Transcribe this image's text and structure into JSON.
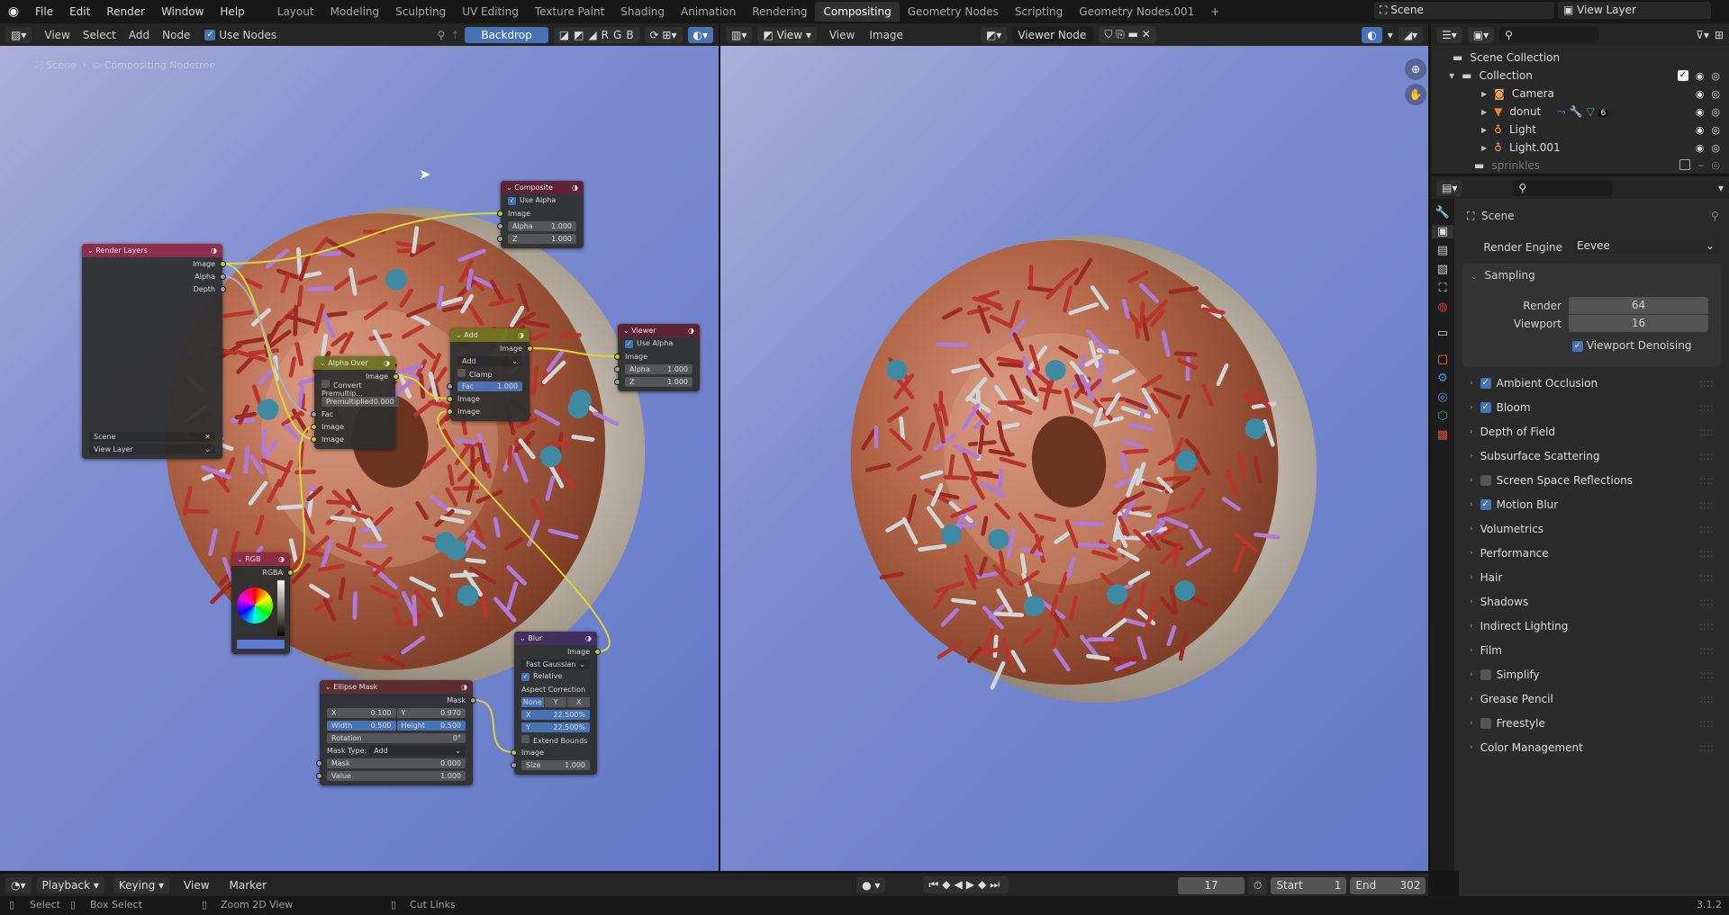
{
  "topbar": {
    "menus": [
      "File",
      "Edit",
      "Render",
      "Window",
      "Help"
    ],
    "workspaces": [
      "Layout",
      "Modeling",
      "Sculpting",
      "UV Editing",
      "Texture Paint",
      "Shading",
      "Animation",
      "Rendering",
      "Compositing",
      "Geometry Nodes",
      "Scripting",
      "Geometry Nodes.001"
    ],
    "active_workspace": "Compositing",
    "add_tab": "+",
    "scene": "Scene",
    "view_layer": "View Layer"
  },
  "node_editor": {
    "menus": [
      "View",
      "Select",
      "Add",
      "Node"
    ],
    "use_nodes_label": "Use Nodes",
    "use_nodes": true,
    "backdrop_label": "Backdrop",
    "channels": [
      "R",
      "G",
      "B"
    ],
    "breadcrumb": [
      "Scene",
      "Compositing Nodetree"
    ]
  },
  "nodes": [
    {
      "id": "render_layers",
      "title": "Render Layers",
      "color": "#8c2a45",
      "rows": [
        {
          "t": "out",
          "label": "Image",
          "s": "color"
        },
        {
          "t": "out",
          "label": "Alpha",
          "s": "value"
        },
        {
          "t": "out",
          "label": "Depth",
          "s": "value"
        },
        {
          "t": "spacer"
        },
        {
          "t": "scene",
          "label": "Scene"
        },
        {
          "t": "drop",
          "label": "View Layer"
        }
      ]
    },
    {
      "id": "composite",
      "title": "Composite",
      "color": "#5c1f2f",
      "rows": [
        {
          "t": "check",
          "label": "Use Alpha",
          "checked": true
        },
        {
          "t": "in",
          "label": "Image",
          "s": "color"
        },
        {
          "t": "field",
          "label": "Alpha",
          "value": "1.000",
          "s": "value"
        },
        {
          "t": "field",
          "label": "Z",
          "value": "1.000",
          "s": "value"
        }
      ]
    },
    {
      "id": "alpha_over",
      "title": "Alpha Over",
      "color": "#6e7320",
      "rows": [
        {
          "t": "out",
          "label": "Image",
          "s": "color"
        },
        {
          "t": "check",
          "label": "Convert Premultip...",
          "checked": false
        },
        {
          "t": "field",
          "label": "Premultiplied",
          "value": "0.000"
        },
        {
          "t": "in",
          "label": "Fac",
          "s": "value"
        },
        {
          "t": "in",
          "label": "Image",
          "s": "color"
        },
        {
          "t": "in",
          "label": "Image",
          "s": "color"
        }
      ]
    },
    {
      "id": "add",
      "title": "Add",
      "color": "#6e7320",
      "rows": [
        {
          "t": "out",
          "label": "Image",
          "s": "color"
        },
        {
          "t": "drop",
          "label": "Add"
        },
        {
          "t": "check",
          "label": "Clamp",
          "checked": false
        },
        {
          "t": "field",
          "label": "Fac",
          "value": "1.000",
          "s": "value",
          "acc": true
        },
        {
          "t": "in",
          "label": "Image",
          "s": "color"
        },
        {
          "t": "in",
          "label": "Image",
          "s": "color"
        }
      ]
    },
    {
      "id": "viewer",
      "title": "Viewer",
      "color": "#5c1f2f",
      "rows": [
        {
          "t": "check",
          "label": "Use Alpha",
          "checked": true
        },
        {
          "t": "in",
          "label": "Image",
          "s": "color"
        },
        {
          "t": "field",
          "label": "Alpha",
          "value": "1.000",
          "s": "value"
        },
        {
          "t": "field",
          "label": "Z",
          "value": "1.000",
          "s": "value"
        }
      ]
    },
    {
      "id": "rgb",
      "title": "RGB",
      "color": "#8c2a45",
      "rows": [
        {
          "t": "out",
          "label": "RGBA",
          "s": "color"
        },
        {
          "t": "color",
          "swatch": "#5a78d4"
        }
      ]
    },
    {
      "id": "ellipse_mask",
      "title": "Ellipse Mask",
      "color": "#5a2a2a",
      "rows": [
        {
          "t": "out",
          "label": "Mask",
          "s": "value"
        },
        {
          "t": "pair",
          "a": {
            "label": "X",
            "value": "0.100"
          },
          "b": {
            "label": "Y",
            "value": "0.970"
          }
        },
        {
          "t": "pair",
          "a": {
            "label": "Width",
            "value": "0.500",
            "acc": true
          },
          "b": {
            "label": "Height",
            "value": "0.500",
            "acc": true
          }
        },
        {
          "t": "field",
          "label": "Rotation",
          "value": "0°"
        },
        {
          "t": "drop",
          "label": "Add",
          "prefix": "Mask Type:"
        },
        {
          "t": "field",
          "label": "Mask",
          "value": "0.000",
          "s": "value"
        },
        {
          "t": "field",
          "label": "Value",
          "value": "1.000",
          "s": "value"
        }
      ]
    },
    {
      "id": "blur",
      "title": "Blur",
      "color": "#3f2a5c",
      "rows": [
        {
          "t": "out",
          "label": "Image",
          "s": "color"
        },
        {
          "t": "drop",
          "label": "Fast Gaussian"
        },
        {
          "t": "check",
          "label": "Relative",
          "checked": true
        },
        {
          "t": "text",
          "label": "Aspect Correction"
        },
        {
          "t": "seg",
          "options": [
            "None",
            "Y",
            "X"
          ],
          "active": "None"
        },
        {
          "t": "field",
          "label": "X",
          "value": "22.500%",
          "acc": true
        },
        {
          "t": "field",
          "label": "Y",
          "value": "22.500%",
          "acc": true
        },
        {
          "t": "check",
          "label": "Extend Bounds",
          "checked": false
        },
        {
          "t": "in",
          "label": "Image",
          "s": "color"
        },
        {
          "t": "field",
          "label": "Size",
          "value": "1.000",
          "s": "value"
        }
      ]
    }
  ],
  "links": [
    [
      "render_layers",
      0,
      "composite",
      1
    ],
    [
      "render_layers",
      0,
      "alpha_over",
      5
    ],
    [
      "render_layers",
      1,
      "alpha_over",
      3
    ],
    [
      "rgb",
      0,
      "alpha_over",
      4
    ],
    [
      "alpha_over",
      0,
      "add",
      4
    ],
    [
      "add",
      0,
      "viewer",
      1
    ],
    [
      "blur",
      0,
      "add",
      5
    ],
    [
      "ellipse_mask",
      0,
      "blur",
      8
    ]
  ],
  "socket_colors": {
    "color": "#c7c729",
    "value": "#a1a1a1"
  },
  "image_editor": {
    "menus": [
      "View",
      "View",
      "Image"
    ],
    "image_name": "Viewer Node"
  },
  "outliner": {
    "rows": [
      {
        "name": "Scene Collection",
        "level": 0,
        "icon": "collection-icon"
      },
      {
        "name": "Collection",
        "level": 1,
        "icon": "collection-icon",
        "checked": true
      },
      {
        "name": "Camera",
        "level": 2,
        "icon": "camera-icon"
      },
      {
        "name": "donut",
        "level": 2,
        "icon": "mesh-icon",
        "badge": "6"
      },
      {
        "name": "Light",
        "level": 2,
        "icon": "light-icon"
      },
      {
        "name": "Light.001",
        "level": 2,
        "icon": "light-icon"
      },
      {
        "name": "sprinkles",
        "level": 1,
        "icon": "collection-icon",
        "excluded": true
      }
    ]
  },
  "properties": {
    "context": "Scene",
    "render_engine_label": "Render Engine",
    "render_engine": "Eevee",
    "sampling": {
      "title": "Sampling",
      "render_label": "Render",
      "render": "64",
      "viewport_label": "Viewport",
      "viewport": "16",
      "denoise_label": "Viewport Denoising",
      "denoise": true
    },
    "panels": [
      {
        "label": "Ambient Occlusion",
        "check": true
      },
      {
        "label": "Bloom",
        "check": true
      },
      {
        "label": "Depth of Field"
      },
      {
        "label": "Subsurface Scattering"
      },
      {
        "label": "Screen Space Reflections",
        "check": false
      },
      {
        "label": "Motion Blur",
        "check": true
      },
      {
        "label": "Volumetrics"
      },
      {
        "label": "Performance"
      },
      {
        "label": "Hair"
      },
      {
        "label": "Shadows"
      },
      {
        "label": "Indirect Lighting"
      },
      {
        "label": "Film"
      },
      {
        "label": "Simplify",
        "check": false
      },
      {
        "label": "Grease Pencil"
      },
      {
        "label": "Freestyle",
        "check": false
      },
      {
        "label": "Color Management"
      }
    ]
  },
  "timeline": {
    "menus": [
      "Playback",
      "Keying",
      "View",
      "Marker"
    ],
    "current_frame": "17",
    "start_label": "Start",
    "start": "1",
    "end_label": "End",
    "end": "302"
  },
  "statusbar": {
    "hints": [
      "Select",
      "Box Select",
      "Zoom 2D View",
      "Cut Links"
    ],
    "version": "3.1.2"
  }
}
